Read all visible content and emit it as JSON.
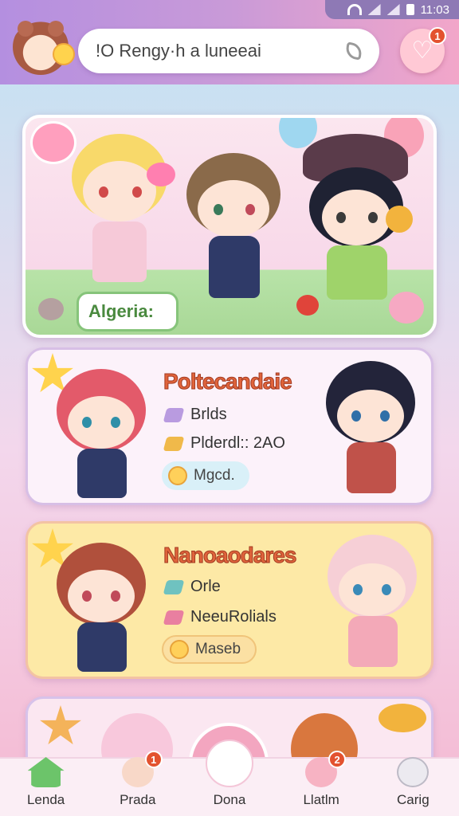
{
  "status": {
    "time": "11:03"
  },
  "search": {
    "text": "!O Rengy·h a luneeai"
  },
  "header": {
    "heart_badge": "1"
  },
  "hero": {
    "tag_label": "Algeria:"
  },
  "cards": [
    {
      "title": "Poltecandaie",
      "rows": [
        {
          "label": "Brlds",
          "icon_color": "#b99be0"
        },
        {
          "label": "Plderdl:: 2AO",
          "icon_color": "#f0b94a"
        }
      ],
      "pill": "Mgcd.",
      "pill_color": "#d9f0f8"
    },
    {
      "title": "Nanoaodares",
      "rows": [
        {
          "label": "Orle",
          "icon_color": "#6fc2c0"
        },
        {
          "label": "NeeuRolials",
          "icon_color": "#e97fa0"
        }
      ],
      "pill": "Maseb",
      "pill_color": "#fbe0a3"
    }
  ],
  "nav": [
    {
      "label": "Lenda",
      "icon": "home-icon",
      "badge": ""
    },
    {
      "label": "Prada",
      "icon": "friend-icon",
      "badge": "1"
    },
    {
      "label": "Dona",
      "icon": "book-icon",
      "badge": ""
    },
    {
      "label": "Llatlm",
      "icon": "chat-icon",
      "badge": "2"
    },
    {
      "label": "Carig",
      "icon": "mascot-icon",
      "badge": ""
    }
  ],
  "colors": {
    "accent": "#e0643b",
    "topbar_start": "#b48fe0",
    "topbar_end": "#f2a6c9"
  }
}
